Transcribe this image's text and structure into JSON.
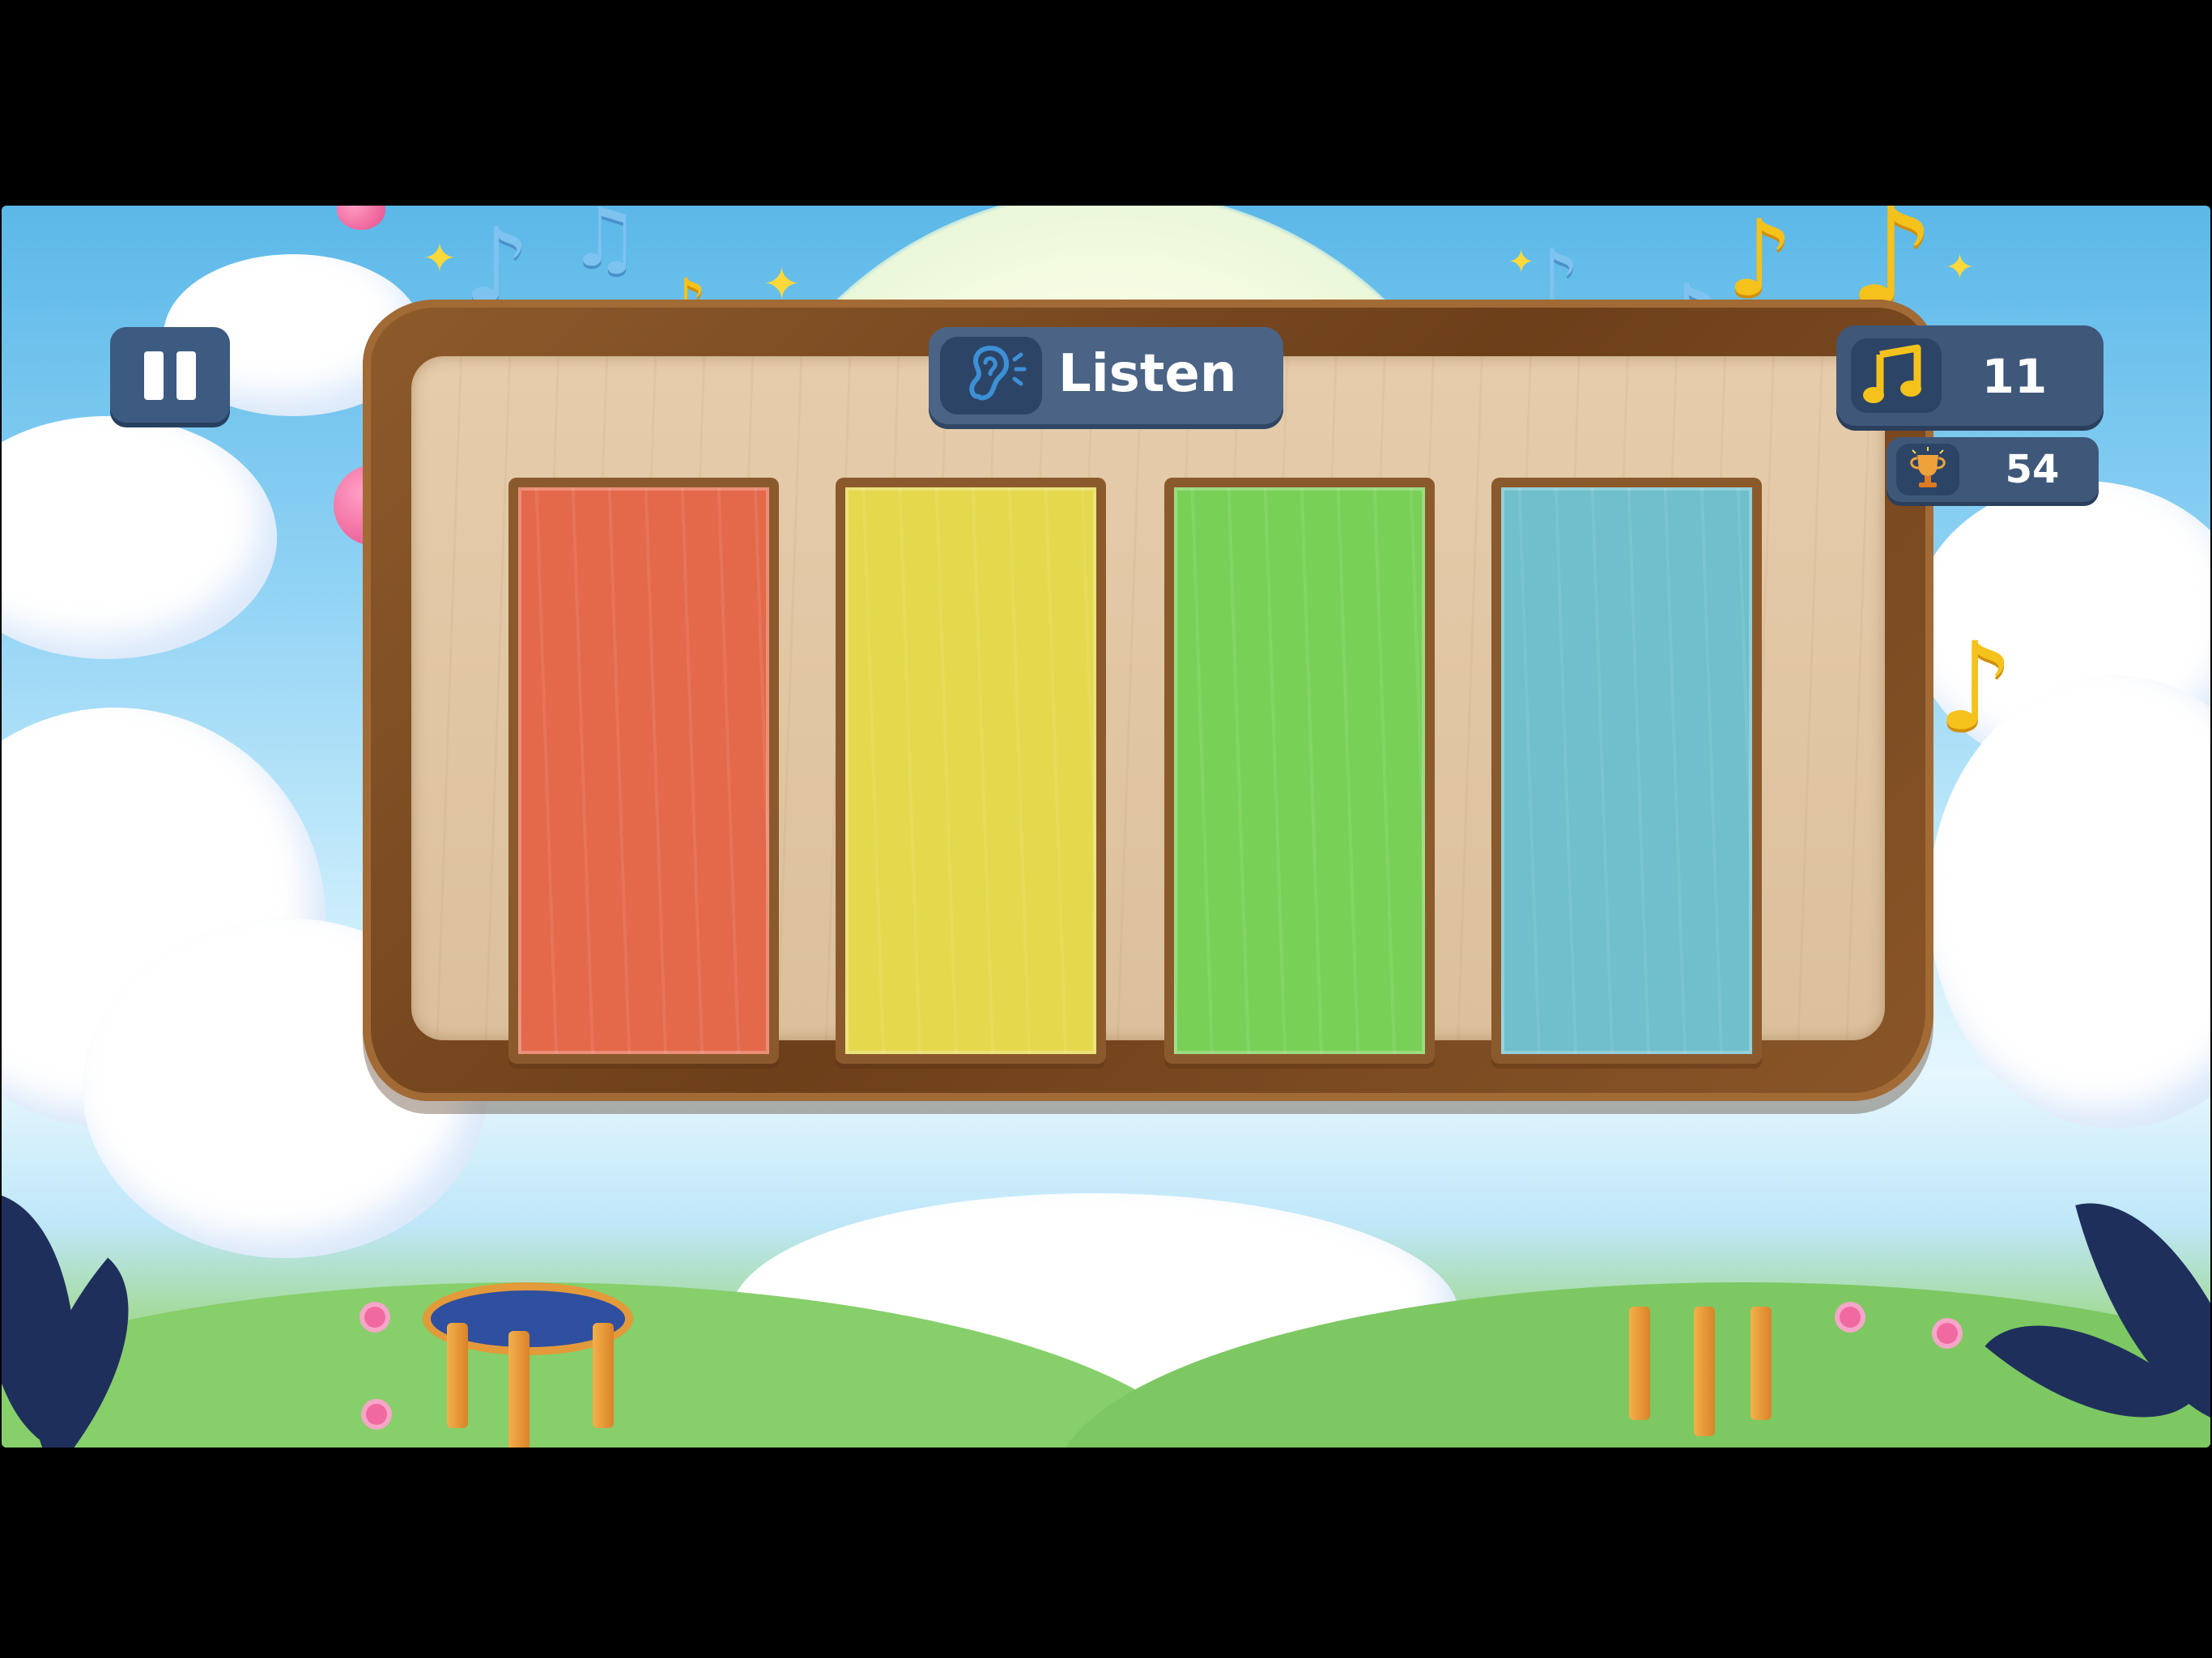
{
  "hud": {
    "pause_icon": "pause-icon",
    "listen_label": "Listen",
    "listen_icon": "ear-icon",
    "notes_icon": "music-note-icon",
    "notes_count": "11",
    "trophy_icon": "trophy-icon",
    "trophy_score": "54"
  },
  "xylophone": {
    "keys": [
      {
        "color_name": "red",
        "color": "#e4684a"
      },
      {
        "color_name": "yellow",
        "color": "#e4d94c"
      },
      {
        "color_name": "green",
        "color": "#78d156"
      },
      {
        "color_name": "blue",
        "color": "#6fbfcc"
      }
    ]
  },
  "colors": {
    "hud_panel": "#3f5879",
    "hud_icon_box": "#2c4466",
    "board_wood": "#8d5a2b",
    "board_plank": "#e6ccab",
    "note_gold": "#f5c21b"
  }
}
